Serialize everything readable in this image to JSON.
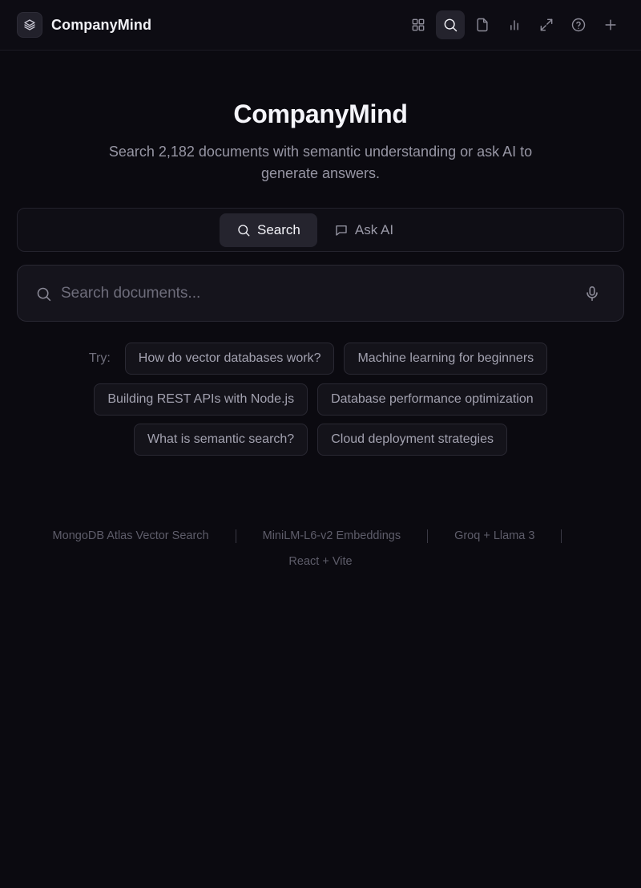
{
  "header": {
    "brand": "CompanyMind",
    "nav_icons": [
      "grid-icon",
      "search-icon",
      "document-icon",
      "chart-icon",
      "expand-icon",
      "help-icon",
      "plus-icon"
    ],
    "active_nav": "search-icon"
  },
  "hero": {
    "title": "CompanyMind",
    "subtitle": "Search 2,182 documents with semantic understanding or ask AI to generate answers."
  },
  "modes": {
    "search_label": "Search",
    "ask_label": "Ask AI",
    "active": "Search"
  },
  "search": {
    "placeholder": "Search documents...",
    "value": ""
  },
  "suggestions": {
    "try_label": "Try:",
    "items": [
      "How do vector databases work?",
      "Machine learning for beginners",
      "Building REST APIs with Node.js",
      "Database performance optimization",
      "What is semantic search?",
      "Cloud deployment strategies"
    ]
  },
  "footer": {
    "items": [
      "MongoDB Atlas Vector Search",
      "MiniLM-L6-v2 Embeddings",
      "Groq + Llama 3",
      "React + Vite"
    ]
  },
  "colors": {
    "background": "#0b0a10",
    "panel": "#0f0e15",
    "active_tab": "#25242e",
    "text_primary": "#f5f5fa",
    "text_muted": "#9796a4"
  }
}
